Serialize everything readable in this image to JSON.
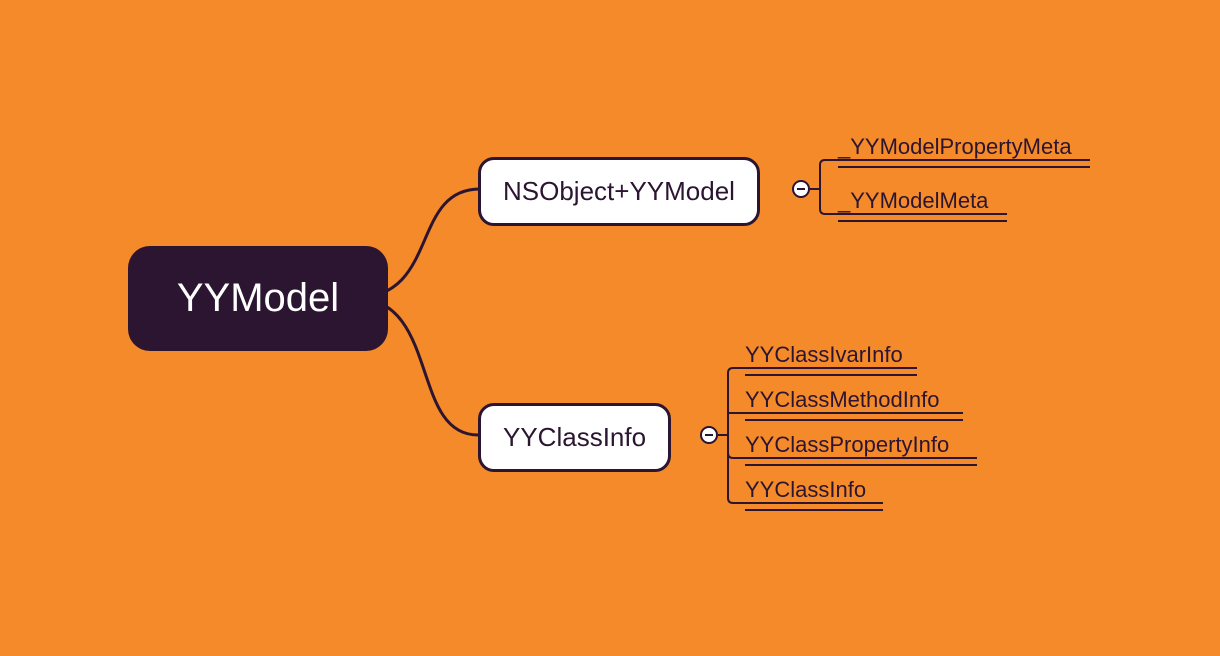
{
  "root": {
    "label": "YYModel"
  },
  "children": [
    {
      "label": "NSObject+YYModel",
      "leaves": [
        {
          "label": "_YYModelPropertyMeta"
        },
        {
          "label": "_YYModelMeta"
        }
      ]
    },
    {
      "label": "YYClassInfo",
      "leaves": [
        {
          "label": "YYClassIvarInfo"
        },
        {
          "label": "YYClassMethodInfo"
        },
        {
          "label": "YYClassPropertyInfo"
        },
        {
          "label": "YYClassInfo"
        }
      ]
    }
  ],
  "colors": {
    "background": "#f58a2a",
    "nodeDark": "#2b1530",
    "nodeLight": "#ffffff"
  }
}
